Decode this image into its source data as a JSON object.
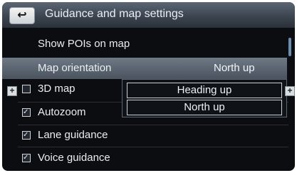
{
  "header": {
    "back_label": "↩",
    "title": "Guidance and map settings"
  },
  "rows": [
    {
      "label": "Show POIs on map"
    },
    {
      "label": "Map orientation",
      "value": "North up"
    },
    {
      "label": "3D map",
      "checked": false
    },
    {
      "label": "Autozoom",
      "checked": true
    },
    {
      "label": "Lane guidance",
      "checked": true
    },
    {
      "label": "Voice guidance",
      "checked": true
    }
  ],
  "dropdown": {
    "options": [
      "Heading up",
      "North up"
    ]
  },
  "side_controls": {
    "left_label": "+",
    "right_label": "+"
  }
}
